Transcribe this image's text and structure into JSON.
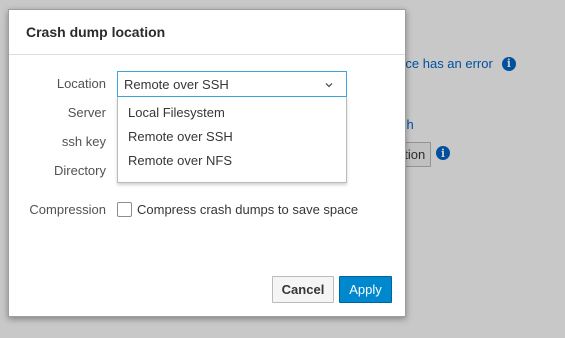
{
  "background": {
    "alert_text": "vice has an error",
    "link_text": "sh",
    "button_text": "ation"
  },
  "dialog": {
    "title": "Crash dump location",
    "fields": {
      "location_label": "Location",
      "server_label": "Server",
      "ssh_key_label": "ssh key",
      "directory_label": "Directory",
      "compression_label": "Compression"
    },
    "location_select": {
      "selected": "Remote over SSH",
      "options": [
        "Local Filesystem",
        "Remote over SSH",
        "Remote over NFS"
      ]
    },
    "compression_checkbox": {
      "label": "Compress crash dumps to save space",
      "checked": false
    },
    "buttons": {
      "cancel": "Cancel",
      "apply": "Apply"
    }
  },
  "colors": {
    "primary": "#0088ce",
    "focus_border": "#39a5dc",
    "link": "#0066cc"
  }
}
